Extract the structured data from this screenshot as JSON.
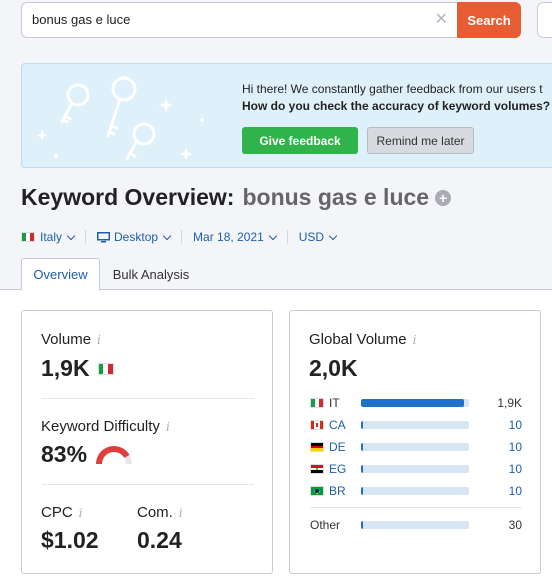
{
  "search": {
    "query": "bonus gas e luce",
    "clear_icon": "close-icon",
    "button_label": "Search"
  },
  "banner": {
    "line1": "Hi there! We constantly gather feedback from our users t",
    "line2": "How do you check the accuracy of keyword volumes? P",
    "feedback_label": "Give feedback",
    "remind_label": "Remind me later"
  },
  "title": {
    "main": "Keyword Overview:",
    "keyword": "bonus gas e luce",
    "add_icon": "+"
  },
  "filters": {
    "country": "Italy",
    "device": "Desktop",
    "date": "Mar 18, 2021",
    "currency": "USD"
  },
  "tabs": [
    {
      "label": "Overview",
      "active": true
    },
    {
      "label": "Bulk Analysis",
      "active": false
    }
  ],
  "metrics": {
    "volume_label": "Volume",
    "volume_value": "1,9K",
    "kd_label": "Keyword Difficulty",
    "kd_value": "83%",
    "kd_percent": 83,
    "cpc_label": "CPC",
    "cpc_value": "$1.02",
    "com_label": "Com.",
    "com_value": "0.24",
    "info_glyph": "i"
  },
  "global_volume": {
    "label": "Global Volume",
    "value": "2,0K",
    "rows": [
      {
        "code": "IT",
        "value": "1,9K",
        "share": 0.95,
        "flag": "it"
      },
      {
        "code": "CA",
        "value": "10",
        "share": 0.01,
        "flag": "ca"
      },
      {
        "code": "DE",
        "value": "10",
        "share": 0.01,
        "flag": "de"
      },
      {
        "code": "EG",
        "value": "10",
        "share": 0.01,
        "flag": "eg"
      },
      {
        "code": "BR",
        "value": "10",
        "share": 0.01,
        "flag": "br"
      }
    ],
    "other": {
      "code": "Other",
      "value": "30",
      "share": 0.015
    }
  },
  "colors": {
    "accent": "#e85c33",
    "link": "#1e5fa8",
    "feedback_green": "#30b34a",
    "kd_red": "#e03d3d",
    "bar_fill": "#1d72c8"
  }
}
